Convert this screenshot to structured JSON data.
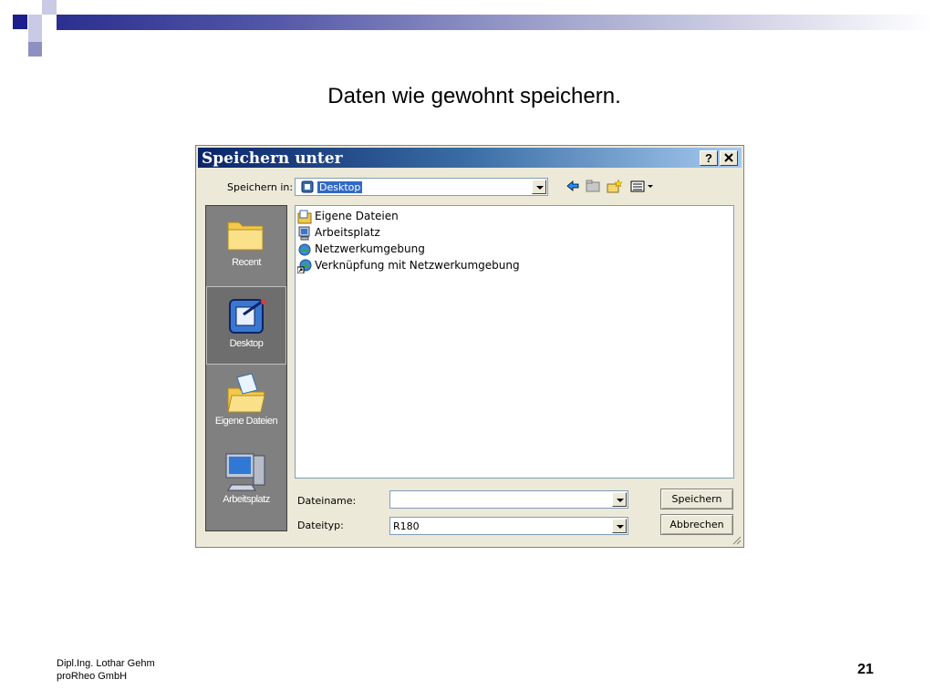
{
  "slide": {
    "title": "Daten wie gewohnt speichern.",
    "footer_line1": "Dipl.Ing. Lothar Gehm",
    "footer_line2": "proRheo GmbH",
    "page_number": "21"
  },
  "dialog": {
    "title": "Speichern unter",
    "help_label": "?",
    "close_label": "✕",
    "save_in_label": "Speichern in:",
    "save_in_value": "Desktop",
    "places": [
      {
        "label": "Recent",
        "icon": "recent-folder-icon"
      },
      {
        "label": "Desktop",
        "icon": "desktop-icon"
      },
      {
        "label": "Eigene Dateien",
        "icon": "my-documents-icon"
      },
      {
        "label": "Arbeitsplatz",
        "icon": "my-computer-icon"
      }
    ],
    "files": [
      {
        "name": "Eigene Dateien",
        "icon": "my-documents-icon"
      },
      {
        "name": "Arbeitsplatz",
        "icon": "my-computer-icon"
      },
      {
        "name": "Netzwerkumgebung",
        "icon": "network-icon"
      },
      {
        "name": "Verknüpfung mit Netzwerkumgebung",
        "icon": "network-shortcut-icon"
      }
    ],
    "filename_label": "Dateiname:",
    "filename_value": "",
    "filetype_label": "Dateityp:",
    "filetype_value": "R180",
    "save_button": "Speichern",
    "cancel_button": "Abbrechen"
  },
  "colors": {
    "slide_accent": "#1c1f8c",
    "titlebar_start": "#0a246a",
    "dialog_face": "#ece9d8",
    "places_bar": "#808080",
    "selection": "#316ac5"
  }
}
